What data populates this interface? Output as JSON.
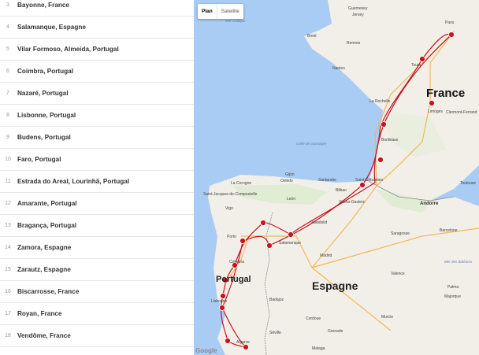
{
  "stops": [
    {
      "num": "3",
      "name": "Bayonne, France"
    },
    {
      "num": "4",
      "name": "Salamanque, Espagne"
    },
    {
      "num": "5",
      "name": "Vilar Formoso, Almeida, Portugal"
    },
    {
      "num": "6",
      "name": "Coimbra, Portugal"
    },
    {
      "num": "7",
      "name": "Nazaré, Portugal"
    },
    {
      "num": "8",
      "name": "Lisbonne, Portugal"
    },
    {
      "num": "9",
      "name": "Budens, Portugal"
    },
    {
      "num": "10",
      "name": "Faro, Portugal"
    },
    {
      "num": "11",
      "name": "Estrada do Areal, Lourinhã, Portugal"
    },
    {
      "num": "12",
      "name": "Amarante, Portugal"
    },
    {
      "num": "13",
      "name": "Bragança, Portugal"
    },
    {
      "num": "14",
      "name": "Zamora, Espagne"
    },
    {
      "num": "15",
      "name": "Zarautz, Espagne"
    },
    {
      "num": "16",
      "name": "Biscarrosse, France"
    },
    {
      "num": "17",
      "name": "Royan, France"
    },
    {
      "num": "18",
      "name": "Vendôme, France"
    }
  ],
  "map_type": {
    "plan": "Plan",
    "satellite": "Satellite"
  },
  "countries": {
    "france": "France",
    "spain": "Espagne",
    "portugal": "Portugal",
    "andorra": "Andorre"
  },
  "places": {
    "guernesey": "Guernesey",
    "jersey": "Jersey",
    "brest": "Brest",
    "rennes": "Rennes",
    "nantes": "Nantes",
    "paris": "Paris",
    "tours": "Tours",
    "limoges": "Limoges",
    "clermont": "Clermont-Ferrand",
    "la_rochelle": "La Rochelle",
    "bordeaux": "Bordeaux",
    "toulouse": "Toulouse",
    "saint_sebastien": "Saint-Sébastien",
    "bilbao": "Bilbao",
    "vitoria": "Vitoria-Gasteiz",
    "oviedo": "Oviedo",
    "gijon": "Gijón",
    "santander": "Santander",
    "la_coruna": "La Corogne",
    "santiago": "Saint-Jacques-de-Compostelle",
    "vigo": "Vigo",
    "leon": "León",
    "porto": "Porto",
    "coimbra": "Coimbra",
    "salamanca": "Salamanque",
    "valladolid": "Valladolid",
    "madrid": "Madrid",
    "lisbon": "Lisbonne",
    "badajoz": "Badajoz",
    "zaragoza": "Saragosse",
    "barcelona": "Barcelone",
    "valencia": "Valence",
    "murcia": "Murcie",
    "granada": "Grenade",
    "malaga": "Malaga",
    "seville": "Séville",
    "cordoba": "Cordoue",
    "algarve": "Algarve",
    "mallorca": "Majorque",
    "palma": "Palma",
    "sea_celtic": "Mer Celtique",
    "sea_biscay": "Golfe de Gascogne",
    "sea_baleares": "Mer des Baléares"
  },
  "attribution": "Google",
  "colors": {
    "route": "#c8141e",
    "water": "#a9ccf4",
    "land": "#f2efe9"
  }
}
